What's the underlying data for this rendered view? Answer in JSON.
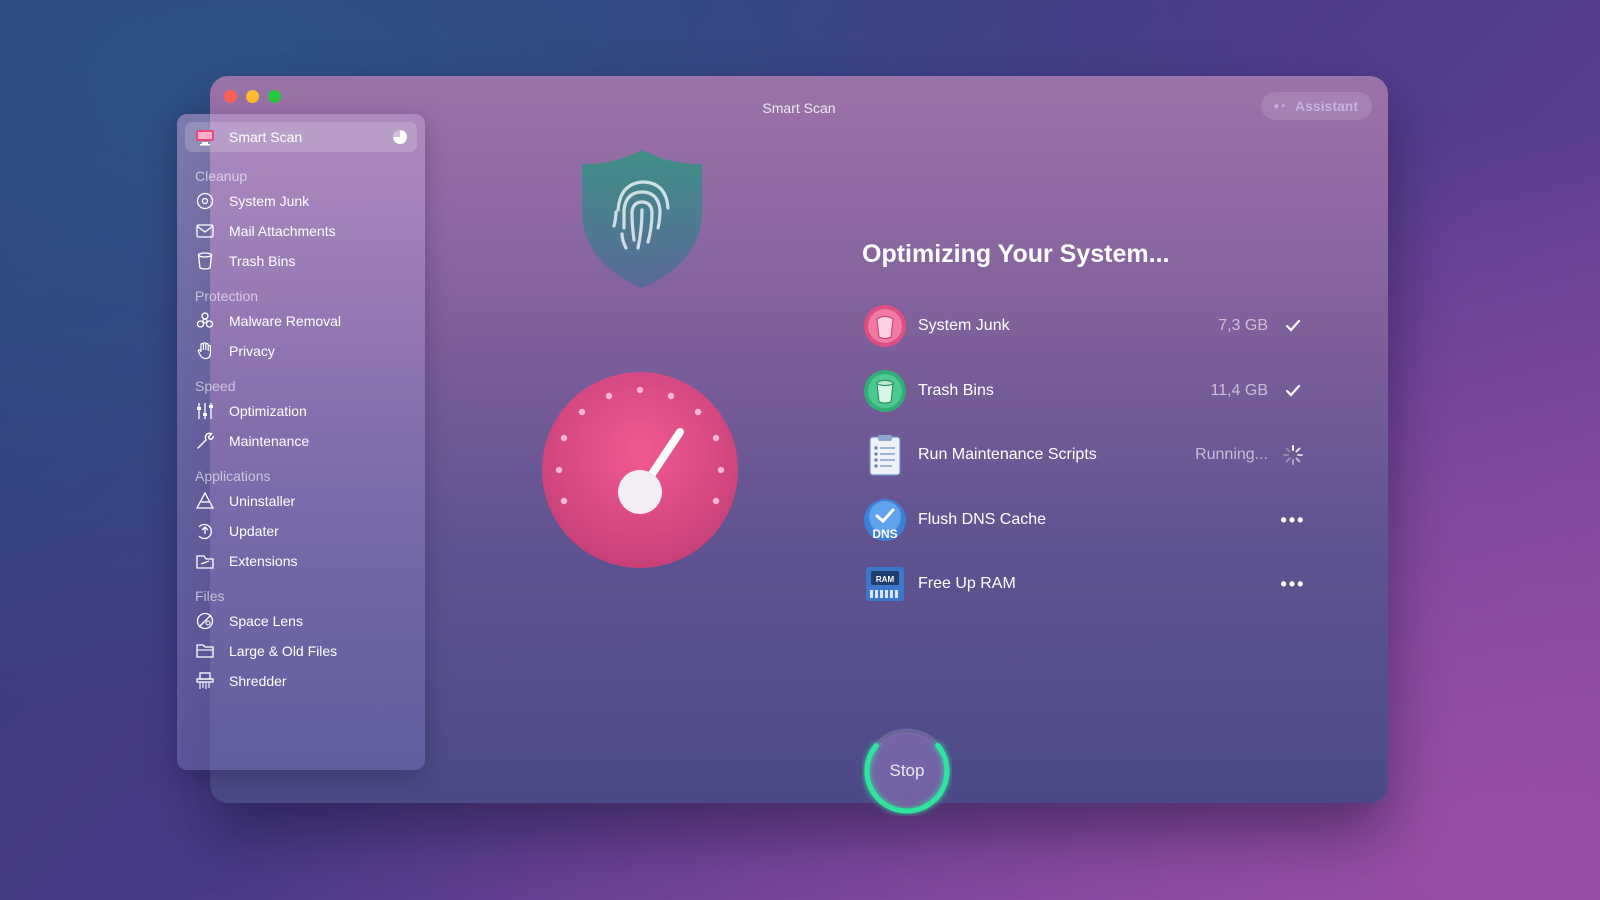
{
  "window": {
    "title": "Smart Scan",
    "assistant_label": "Assistant"
  },
  "sidebar": {
    "active": {
      "label": "Smart Scan",
      "icon": "monitor-icon"
    },
    "sections": [
      {
        "title": "Cleanup",
        "items": [
          {
            "label": "System Junk",
            "icon": "disc-icon"
          },
          {
            "label": "Mail Attachments",
            "icon": "envelope-icon"
          },
          {
            "label": "Trash Bins",
            "icon": "trash-icon"
          }
        ]
      },
      {
        "title": "Protection",
        "items": [
          {
            "label": "Malware Removal",
            "icon": "biohazard-icon"
          },
          {
            "label": "Privacy",
            "icon": "hand-icon"
          }
        ]
      },
      {
        "title": "Speed",
        "items": [
          {
            "label": "Optimization",
            "icon": "sliders-icon"
          },
          {
            "label": "Maintenance",
            "icon": "wrench-icon"
          }
        ]
      },
      {
        "title": "Applications",
        "items": [
          {
            "label": "Uninstaller",
            "icon": "uninstaller-icon"
          },
          {
            "label": "Updater",
            "icon": "updater-icon"
          },
          {
            "label": "Extensions",
            "icon": "extensions-icon"
          }
        ]
      },
      {
        "title": "Files",
        "items": [
          {
            "label": "Space Lens",
            "icon": "lens-icon"
          },
          {
            "label": "Large & Old Files",
            "icon": "folder-icon"
          },
          {
            "label": "Shredder",
            "icon": "shredder-icon"
          }
        ]
      }
    ]
  },
  "main": {
    "heading": "Optimizing Your System...",
    "tasks": [
      {
        "label": "System Junk",
        "size": "7,3 GB",
        "status": "done",
        "icon": "system-junk-icon"
      },
      {
        "label": "Trash Bins",
        "size": "11,4 GB",
        "status": "done",
        "icon": "trash-bins-icon"
      },
      {
        "label": "Run Maintenance Scripts",
        "size": "Running...",
        "status": "running",
        "icon": "clipboard-icon"
      },
      {
        "label": "Flush DNS Cache",
        "size": "",
        "status": "pending",
        "icon": "dns-icon",
        "icon_text": "DNS"
      },
      {
        "label": "Free Up RAM",
        "size": "",
        "status": "pending",
        "icon": "ram-icon",
        "icon_text": "RAM"
      }
    ],
    "stop_label": "Stop",
    "stop_progress": 0.72
  },
  "colors": {
    "accent_green": "#2ee59d",
    "dial_pink": "#e0508a",
    "shield_teal": "#4a8f8a"
  }
}
